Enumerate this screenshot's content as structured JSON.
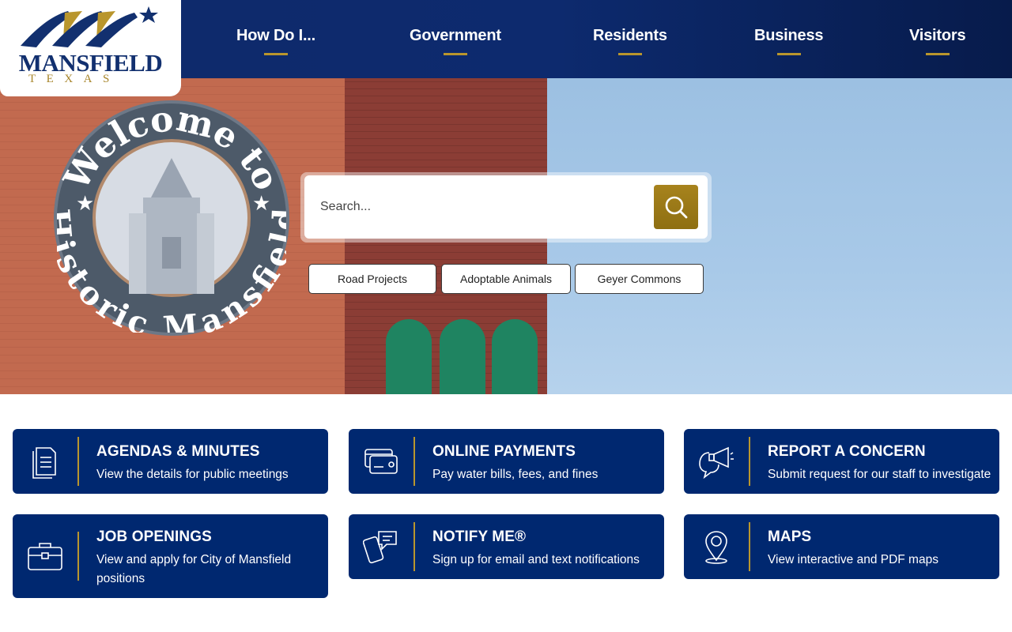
{
  "logo": {
    "name": "MANSFIELD",
    "state": "TEXAS"
  },
  "nav": {
    "items": [
      {
        "label": "How Do I..."
      },
      {
        "label": "Government"
      },
      {
        "label": "Residents"
      },
      {
        "label": "Business"
      },
      {
        "label": "Visitors"
      }
    ]
  },
  "hero": {
    "mural_top": "Welcome to",
    "mural_bottom": "Historic Mansfield"
  },
  "search": {
    "placeholder": "Search...",
    "quick_links": [
      {
        "label": "Road Projects"
      },
      {
        "label": "Adoptable Animals"
      },
      {
        "label": "Geyer Commons"
      }
    ]
  },
  "cards": [
    {
      "title": "AGENDAS & MINUTES",
      "desc": "View the details for public meetings",
      "icon": "document-icon"
    },
    {
      "title": "ONLINE PAYMENTS",
      "desc": "Pay water bills, fees, and fines",
      "icon": "credit-card-icon"
    },
    {
      "title": "REPORT A CONCERN",
      "desc": "Submit request for our staff to investigate",
      "icon": "megaphone-icon"
    },
    {
      "title": "JOB OPENINGS",
      "desc": "View and apply for City of Mansfield positions",
      "icon": "briefcase-icon"
    },
    {
      "title": "NOTIFY ME®",
      "desc": "Sign up for email and text notifications",
      "icon": "phone-chat-icon"
    },
    {
      "title": "MAPS",
      "desc": "View interactive and PDF maps",
      "icon": "map-pin-icon"
    }
  ],
  "colors": {
    "navy": "#002870",
    "gold": "#b9962d",
    "header": "#0f2a6b"
  }
}
